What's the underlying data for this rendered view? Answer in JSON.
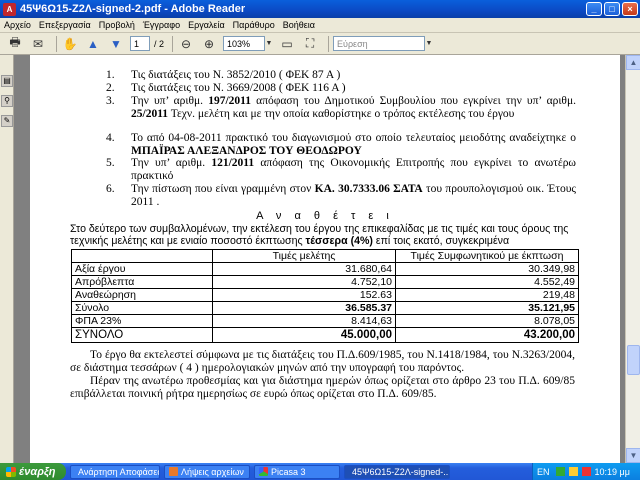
{
  "window": {
    "title": "45Ψ6Ω15-Ζ2Λ-signed-2.pdf - Adobe Reader",
    "minimize": "_",
    "maximize": "□",
    "close": "×"
  },
  "menu": [
    "Αρχείο",
    "Επεξεργασία",
    "Προβολή",
    "Έγγραφο",
    "Εργαλεία",
    "Παράθυρο",
    "Βοήθεια"
  ],
  "toolbar": {
    "page_value": "1",
    "page_total": "/ 2",
    "zoom": "103%",
    "search_placeholder": "Εύρεση"
  },
  "document": {
    "items": [
      {
        "num": "1.",
        "text": "Τις διατάξεις του Ν. 3852/2010 ( ΦΕΚ 87 Α )"
      },
      {
        "num": "2.",
        "text": "Τις διατάξεις του Ν. 3669/2008 ( ΦΕΚ 116 Α )"
      },
      {
        "num": "3.",
        "pre": "Την υπ’ αριθμ. ",
        "b1": "197/2011",
        "mid": " απόφαση του Δημοτικού Συμβουλίου που εγκρίνει την υπ’ αριθμ. ",
        "b2": "25/2011",
        "post": " Τεχν. μελέτη και με την οποία καθορίστηκε ο τρόπος εκτέλεσης του έργου"
      },
      {
        "num": "4.",
        "pre": "Το από 04-08-2011 πρακτικό του διαγωνισμού στο οποίο τελευταίος μειοδότης αναδείχτηκε ο ",
        "b1": "ΜΠΑΪΡΑΣ ΑΛΕΞΑΝΔΡΟΣ ΤΟΥ ΘΕΟΔΩΡΟΥ"
      },
      {
        "num": "5.",
        "pre": " Την υπ’ αριθμ. ",
        "b1": "121/2011",
        "post": " απόφαση της Οικονομικής Επιτροπής που εγκρίνει το ανωτέρω πρακτικό"
      },
      {
        "num": "6.",
        "pre": "Την πίστωση που είναι γραμμένη στον ",
        "b1": "ΚΑ. 30.7333.06 ΣΑΤΑ",
        "post": " του προυπολογισμού οικ. Έτους 2011 ."
      }
    ],
    "heading": "Α ν α θ έ τ ε ι",
    "intro": "Στο δεύτερο των συμβαλλομένων, την εκτέλεση του έργου της επικεφαλίδας με τις τιμές και τους όρους της τεχνικής μελέτης και με ενιαίο ποσοστό έκπτωσης ",
    "intro_bold": "τέσσερα (4%)",
    "intro_end": " επί τοις εκατό, συγκεκριμένα",
    "table": {
      "headers": [
        "",
        "Τιμές μελέτης",
        "Τιμές Συμφωνητικού με έκπτωση"
      ],
      "rows": [
        {
          "label": "Αξία έργου",
          "a": "31.680,64",
          "b": "30.349,98"
        },
        {
          "label": "Απρόβλεπτα",
          "a": "4.752,10",
          "b": "4.552,49"
        },
        {
          "label": "Αναθεώρηση",
          "a": "152.63",
          "b": "219,48"
        },
        {
          "label": "Σύνολο",
          "a": "36.585.37",
          "b": "35.121,95"
        },
        {
          "label": "ΦΠΑ 23%",
          "a": "8.414,63",
          "b": "8.078,05"
        },
        {
          "label": "ΣΥΝΟΛΟ",
          "a": "45.000,00",
          "b": "43.200,00"
        }
      ]
    },
    "para1": "Το έργο θα εκτελεστεί σύμφωνα με τις διατάξεις του Π.Δ.609/1985, του Ν.1418/1984, του Ν.3263/2004, σε διάστημα  τεσσάρων ( 4 ) ημερολογιακών μηνών από την υπογραφή του παρόντος.",
    "para2": "Πέραν της ανωτέρω προθεσμίας και για διάστημα ημερών όπως ορίζεται στο άρθρο 23 του Π.Δ. 609/85 επιβάλλεται ποινική ρήτρα ημερησίως σε ευρώ όπως ορίζεται στο Π.Δ. 609/85."
  },
  "taskbar": {
    "start": "έναρξη",
    "tasks": [
      "Ανάρτηση Αποφάσεω...",
      "Λήψεις αρχείων",
      "Picasa 3",
      "45Ψ6Ω15-Ζ2Λ-signed-..."
    ],
    "lang": "EN",
    "clock": "10:19 μμ"
  }
}
